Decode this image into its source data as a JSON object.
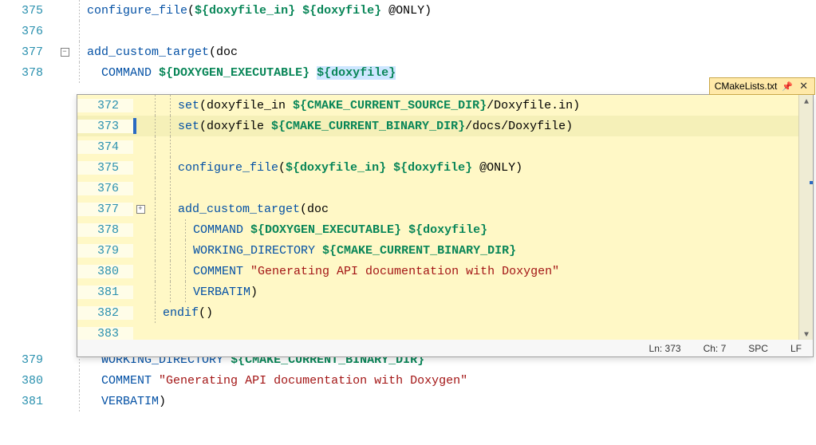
{
  "outer": {
    "lines": [
      {
        "n": 375,
        "tokens": [
          [
            "func",
            "configure_file"
          ],
          [
            "plain",
            "("
          ],
          [
            "varb",
            "${doxyfile_in}"
          ],
          [
            "plain",
            " "
          ],
          [
            "varb",
            "${doxyfile}"
          ],
          [
            "plain",
            " "
          ],
          [
            "at",
            "@ONLY"
          ],
          [
            "plain",
            ")"
          ]
        ]
      },
      {
        "n": 376,
        "tokens": []
      },
      {
        "n": 377,
        "fold": "-",
        "tokens": [
          [
            "func",
            "add_custom_target"
          ],
          [
            "plain",
            "(doc"
          ]
        ]
      },
      {
        "n": 378,
        "tokens": [
          [
            "plain",
            "  "
          ],
          [
            "key",
            "COMMAND"
          ],
          [
            "plain",
            " "
          ],
          [
            "varb",
            "${DOXYGEN_EXECUTABLE}"
          ],
          [
            "plain",
            " "
          ],
          [
            "varb_sel",
            "${doxyfile}"
          ]
        ]
      }
    ],
    "lines_after": [
      {
        "n": 379,
        "tokens": [
          [
            "plain",
            "  "
          ],
          [
            "key",
            "WORKING_DIRECTORY"
          ],
          [
            "plain",
            " "
          ],
          [
            "varb",
            "${CMAKE_CURRENT_BINARY_DIR}"
          ]
        ]
      },
      {
        "n": 380,
        "tokens": [
          [
            "plain",
            "  "
          ],
          [
            "key",
            "COMMENT"
          ],
          [
            "plain",
            " "
          ],
          [
            "str",
            "\"Generating API documentation with Doxygen\""
          ]
        ]
      },
      {
        "n": 381,
        "tokens": [
          [
            "plain",
            "  "
          ],
          [
            "key",
            "VERBATIM"
          ],
          [
            "plain",
            ")"
          ]
        ]
      }
    ]
  },
  "peek": {
    "tab_title": "CMakeLists.txt",
    "lines": [
      {
        "n": 372,
        "indent": 2,
        "tokens": [
          [
            "func",
            "set"
          ],
          [
            "plain",
            "(doxyfile_in "
          ],
          [
            "varb",
            "${CMAKE_CURRENT_SOURCE_DIR}"
          ],
          [
            "plain",
            "/Doxyfile.in)"
          ]
        ]
      },
      {
        "n": 373,
        "indent": 2,
        "current": true,
        "tokens": [
          [
            "func",
            "set"
          ],
          [
            "plain",
            "(doxyfile "
          ],
          [
            "varb",
            "${CMAKE_CURRENT_BINARY_DIR}"
          ],
          [
            "plain",
            "/docs/Doxyfile)"
          ]
        ]
      },
      {
        "n": 374,
        "indent": 2,
        "tokens": []
      },
      {
        "n": 375,
        "indent": 2,
        "tokens": [
          [
            "func",
            "configure_file"
          ],
          [
            "plain",
            "("
          ],
          [
            "varb",
            "${doxyfile_in}"
          ],
          [
            "plain",
            " "
          ],
          [
            "varb",
            "${doxyfile}"
          ],
          [
            "plain",
            " "
          ],
          [
            "at",
            "@ONLY"
          ],
          [
            "plain",
            ")"
          ]
        ]
      },
      {
        "n": 376,
        "indent": 2,
        "tokens": []
      },
      {
        "n": 377,
        "indent": 2,
        "fold": "+",
        "tokens": [
          [
            "func",
            "add_custom_target"
          ],
          [
            "plain",
            "(doc"
          ]
        ]
      },
      {
        "n": 378,
        "indent": 3,
        "tokens": [
          [
            "key",
            "COMMAND"
          ],
          [
            "plain",
            " "
          ],
          [
            "varb",
            "${DOXYGEN_EXECUTABLE}"
          ],
          [
            "plain",
            " "
          ],
          [
            "varb",
            "${doxyfile}"
          ]
        ]
      },
      {
        "n": 379,
        "indent": 3,
        "tokens": [
          [
            "key",
            "WORKING_DIRECTORY"
          ],
          [
            "plain",
            " "
          ],
          [
            "varb",
            "${CMAKE_CURRENT_BINARY_DIR}"
          ]
        ]
      },
      {
        "n": 380,
        "indent": 3,
        "tokens": [
          [
            "key",
            "COMMENT"
          ],
          [
            "plain",
            " "
          ],
          [
            "str",
            "\"Generating API documentation with Doxygen\""
          ]
        ]
      },
      {
        "n": 381,
        "indent": 3,
        "tokens": [
          [
            "key",
            "VERBATIM"
          ],
          [
            "plain",
            ")"
          ]
        ]
      },
      {
        "n": 382,
        "indent": 1,
        "tokens": [
          [
            "func",
            "endif"
          ],
          [
            "plain",
            "()"
          ]
        ]
      },
      {
        "n": 383,
        "indent": 0,
        "tokens": []
      }
    ]
  },
  "status": {
    "ln_label": "Ln:",
    "ln": "373",
    "ch_label": "Ch:",
    "ch": "7",
    "enc": "SPC",
    "eol": "LF"
  }
}
